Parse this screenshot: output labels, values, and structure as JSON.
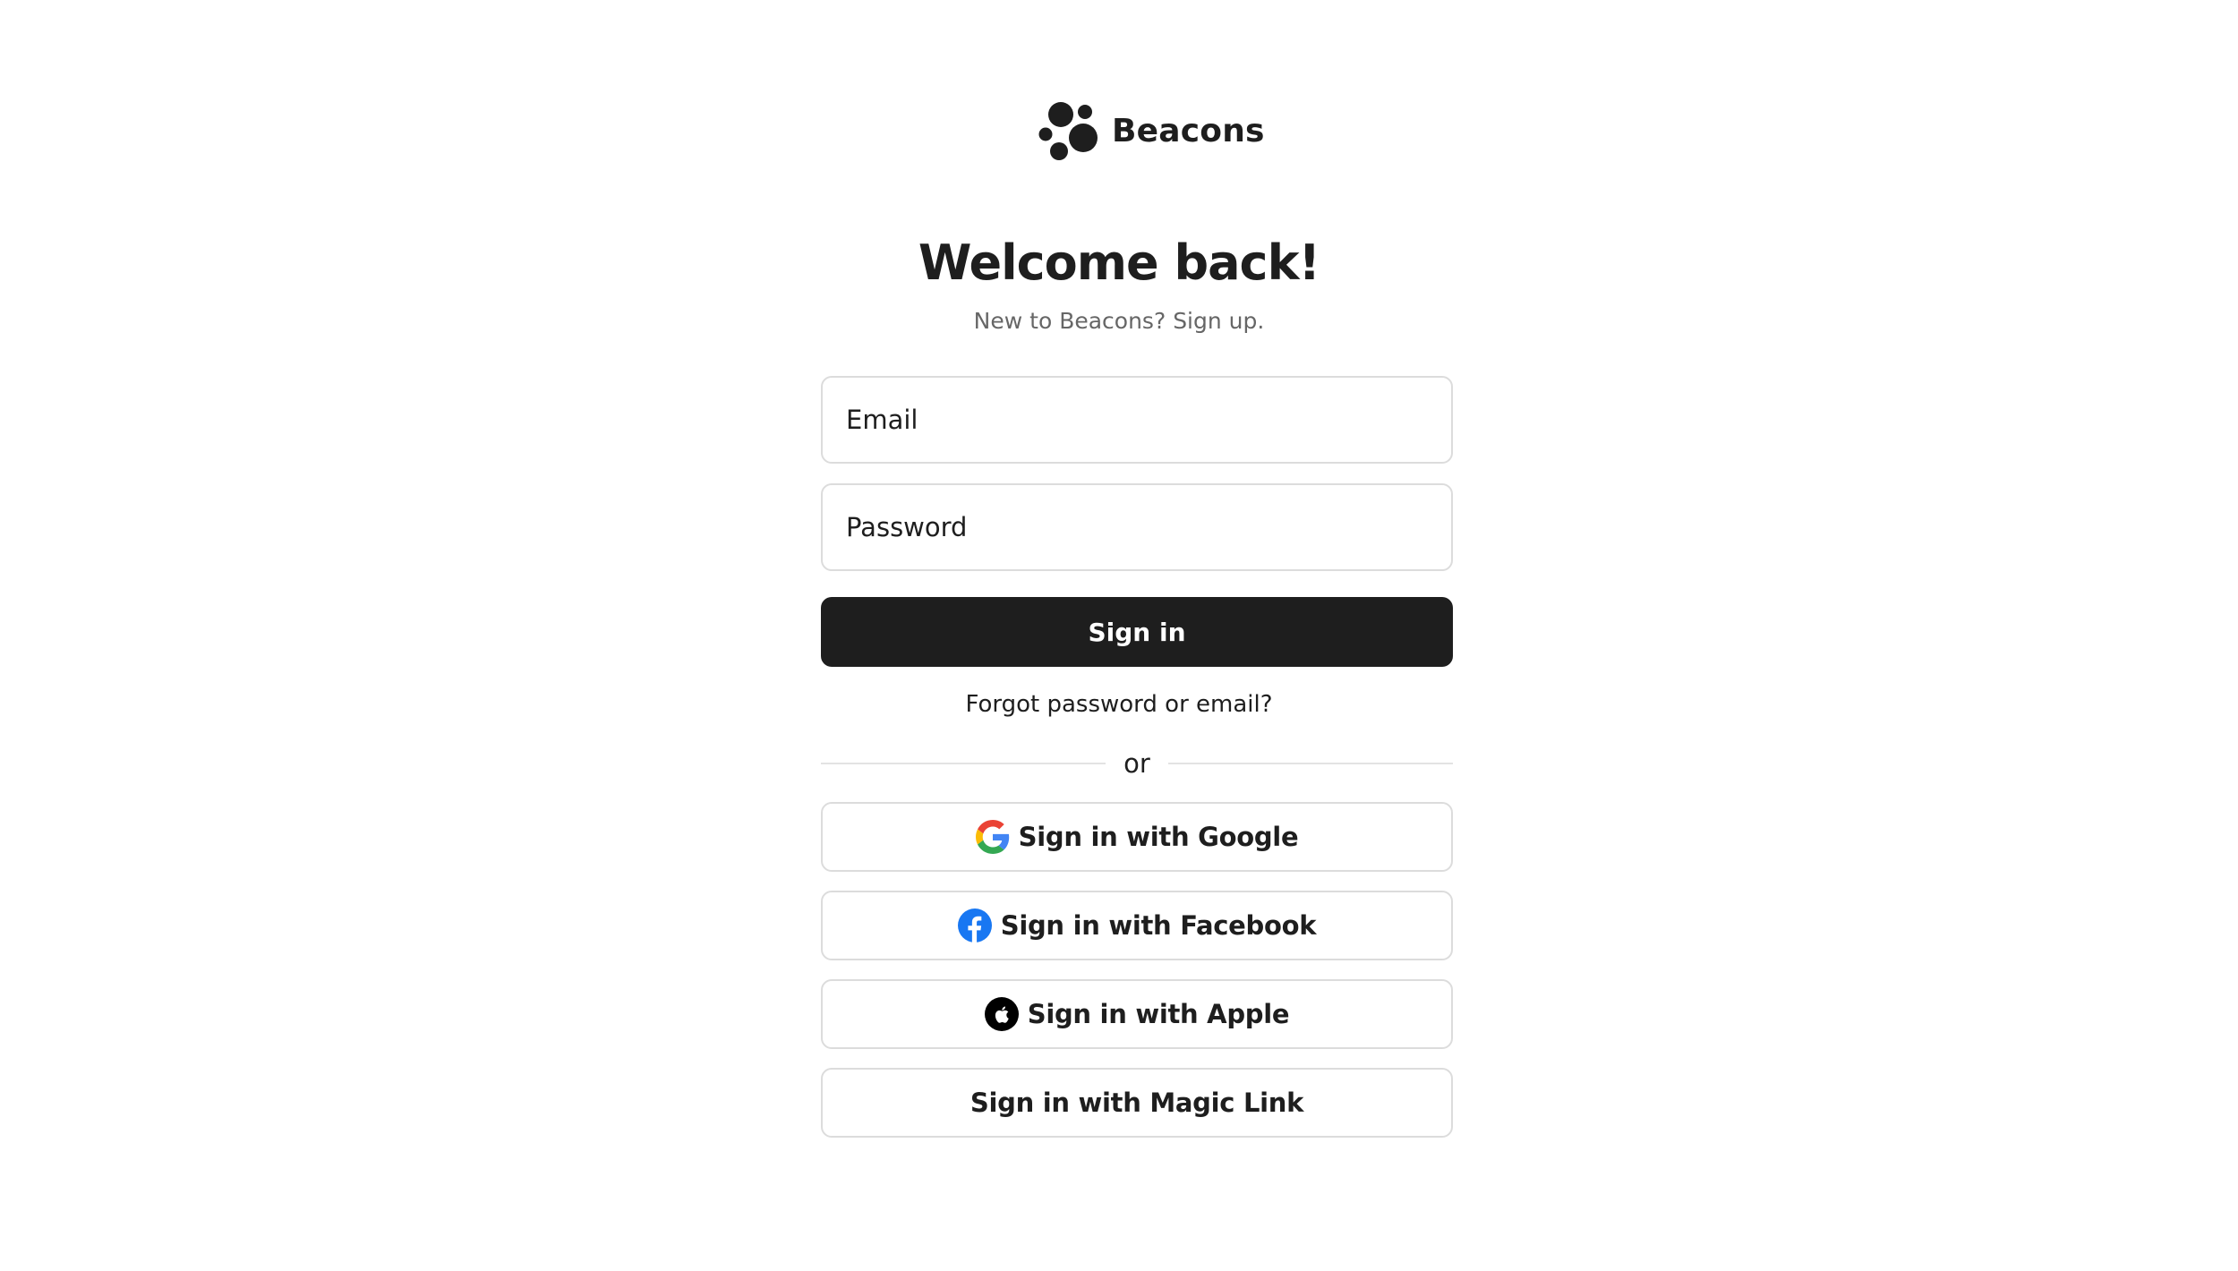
{
  "brand": {
    "name": "Beacons"
  },
  "login": {
    "heading": "Welcome back!",
    "subline_prefix": "New to Beacons?",
    "signup_link": "Sign up.",
    "email_placeholder": "Email",
    "password_placeholder": "Password",
    "sign_in_label": "Sign in",
    "forgot_label": "Forgot password or email?",
    "divider_label": "or"
  },
  "social": {
    "google_label": "Sign in with Google",
    "facebook_label": "Sign in with Facebook",
    "apple_label": "Sign in with Apple",
    "magic_label": "Sign in with Magic Link"
  },
  "icons": {
    "logo": "beacons-logo-icon",
    "google": "google-icon",
    "facebook": "facebook-icon",
    "apple": "apple-icon"
  },
  "colors": {
    "primary": "#1e1e1e",
    "muted_text": "#666666",
    "border": "#dcdcdc",
    "facebook_blue": "#1877f2",
    "google_blue": "#4285f4",
    "google_red": "#ea4335",
    "google_yellow": "#fbbc05",
    "google_green": "#34a853"
  }
}
